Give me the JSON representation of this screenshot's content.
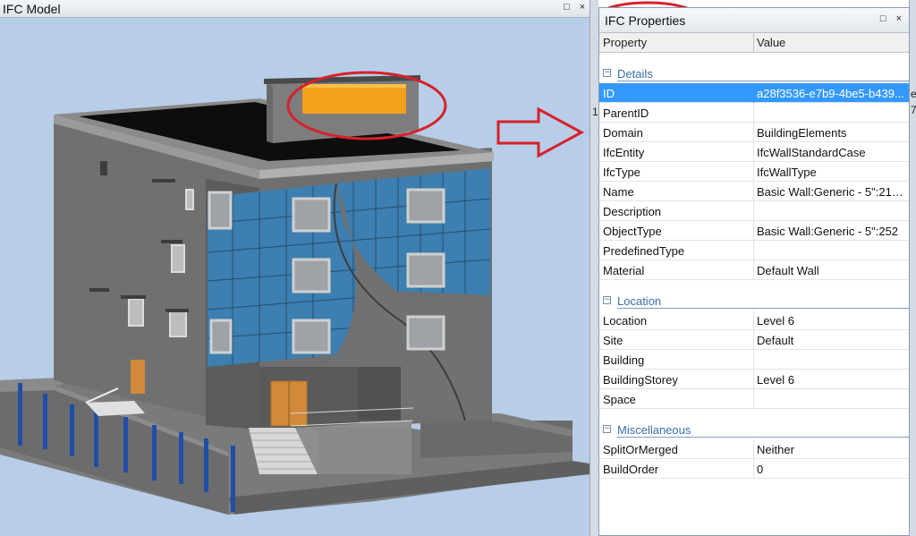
{
  "model_window": {
    "title": "IFC Model",
    "buttons": [
      "□",
      "×"
    ]
  },
  "properties_window": {
    "title": "IFC Properties",
    "buttons": [
      "□",
      "×"
    ],
    "columns": {
      "property": "Property",
      "value": "Value"
    },
    "categories": [
      {
        "name": "Details",
        "rows": [
          {
            "key": "ID",
            "value": "a28f3536-e7b9-4be5-b439...",
            "selected": true
          },
          {
            "key": "ParentID",
            "value": ""
          },
          {
            "key": "Domain",
            "value": "BuildingElements"
          },
          {
            "key": "IfcEntity",
            "value": "IfcWallStandardCase"
          },
          {
            "key": "IfcType",
            "value": "IfcWallType"
          },
          {
            "key": "Name",
            "value": "Basic Wall:Generic - 5\":215..."
          },
          {
            "key": "Description",
            "value": ""
          },
          {
            "key": "ObjectType",
            "value": "Basic Wall:Generic - 5\":252"
          },
          {
            "key": "PredefinedType",
            "value": ""
          },
          {
            "key": "Material",
            "value": "Default Wall"
          }
        ]
      },
      {
        "name": "Location",
        "rows": [
          {
            "key": "Location",
            "value": "Level 6"
          },
          {
            "key": "Site",
            "value": "Default"
          },
          {
            "key": "Building",
            "value": ""
          },
          {
            "key": "BuildingStorey",
            "value": "Level 6"
          },
          {
            "key": "Space",
            "value": ""
          }
        ]
      },
      {
        "name": "Miscellaneous",
        "rows": [
          {
            "key": "SplitOrMerged",
            "value": "Neither"
          },
          {
            "key": "BuildOrder",
            "value": "0"
          }
        ]
      }
    ]
  },
  "edge_fragments": {
    "left": "1",
    "right_top": "e",
    "right_bottom": "7"
  },
  "colors": {
    "sky": "#b8cde8",
    "selection": "#3399ff",
    "category_text": "#3a6ea5",
    "annotation_red": "#d8202a",
    "highlight_orange": "#f5a01a",
    "glass_blue": "#3c7fb0"
  }
}
